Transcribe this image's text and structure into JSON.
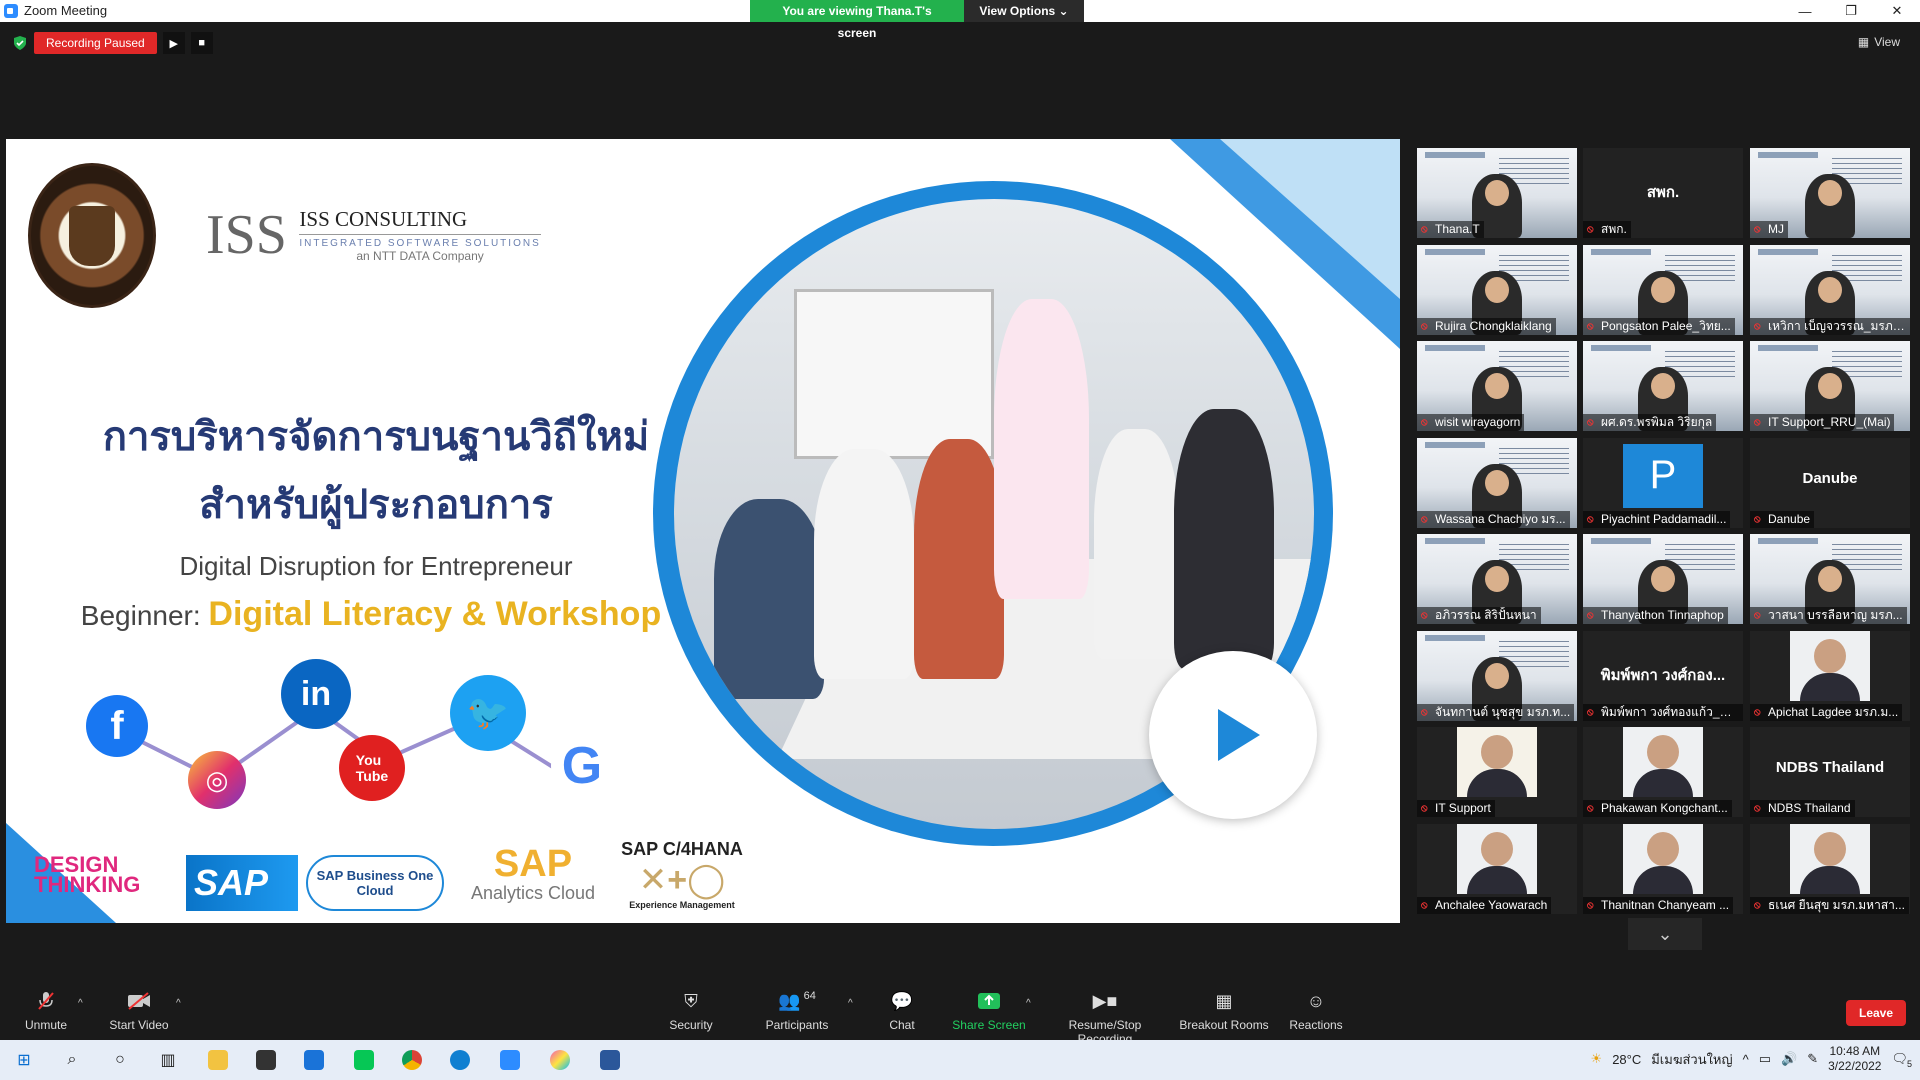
{
  "window": {
    "title": "Zoom Meeting",
    "controls": [
      "—",
      "❐",
      "✕"
    ]
  },
  "viewing": {
    "message": "You are viewing Thana.T's screen",
    "options_label": "View Options ⌄"
  },
  "recording": {
    "status": "Recording Paused"
  },
  "view_button": {
    "label": "View"
  },
  "slide": {
    "company_name": "ISS CONSULTING",
    "company_sub": "INTEGRATED SOFTWARE SOLUTIONS",
    "company_tag": "an NTT DATA Company",
    "iss_mark": "ISS",
    "title_line1": "การบริหารจัดการบนฐานวิถีใหม่",
    "title_line2": "สำหรับผู้ประกอบการ",
    "subtitle": "Digital Disruption for Entrepreneur",
    "level_prefix": "Beginner: ",
    "level_title": "Digital Literacy & Workshop",
    "brands": {
      "design_thinking": "DESIGN THINKING",
      "sap": "SAP",
      "sap_b1": "SAP Business One Cloud",
      "sap_ac_top": "SAP",
      "sap_ac_bottom": "Analytics Cloud",
      "c4hana": "SAP C/4HANA",
      "xm": "Experience Management"
    }
  },
  "gallery": [
    {
      "name": "Thana.T",
      "type": "video",
      "active": true
    },
    {
      "name": "สพก.",
      "type": "text",
      "big": "สพก."
    },
    {
      "name": "MJ",
      "type": "video"
    },
    {
      "name": "Rujira Chongklaiklang",
      "type": "video"
    },
    {
      "name": "Pongsaton Palee_วิทย...",
      "type": "video"
    },
    {
      "name": "เหวิกา เบ็ญจวรรณ_มรภ ...",
      "type": "video"
    },
    {
      "name": "wisit wirayagorn",
      "type": "video"
    },
    {
      "name": "ผศ.ดร.พรพิมล วิริยกุล",
      "type": "video"
    },
    {
      "name": "IT Support_RRU_(Mai)",
      "type": "video"
    },
    {
      "name": "Wassana Chachiyo มร...",
      "type": "video"
    },
    {
      "name": "Piyachint Paddamadil...",
      "type": "letter",
      "big": "P"
    },
    {
      "name": "Danube",
      "type": "text",
      "big": "Danube"
    },
    {
      "name": "อภิวรรณ สิริปั้นหนา",
      "type": "video"
    },
    {
      "name": "Thanyathon Tinnaphop",
      "type": "video"
    },
    {
      "name": "วาสนา บรรลือหาญ มรภ...",
      "type": "video"
    },
    {
      "name": "จันทกานต์ นุชสุข มรภ.ท...",
      "type": "video"
    },
    {
      "name": "พิมพ์พกา วงศ์ทองแก้ว_มร...",
      "type": "text",
      "big": "พิมพ์พกา วงศ์กอง..."
    },
    {
      "name": "Apichat Lagdee มรภ.ม...",
      "type": "portrait"
    },
    {
      "name": "IT Support",
      "type": "logo"
    },
    {
      "name": "Phakawan Kongchant...",
      "type": "portrait"
    },
    {
      "name": "NDBS Thailand",
      "type": "text",
      "big": "NDBS Thailand"
    },
    {
      "name": "Anchalee Yaowarach",
      "type": "portrait"
    },
    {
      "name": "Thanitnan Chanyeam ...",
      "type": "portrait"
    },
    {
      "name": "ธเนศ ยืนสุข มรภ.มหาสา...",
      "type": "portrait"
    }
  ],
  "toolbar": {
    "unmute": "Unmute",
    "start_video": "Start Video",
    "security": "Security",
    "participants": "Participants",
    "participant_count": "64",
    "chat": "Chat",
    "share_screen": "Share Screen",
    "resume_stop": "Resume/Stop Recording",
    "breakout": "Breakout Rooms",
    "reactions": "Reactions",
    "leave": "Leave"
  },
  "taskbar": {
    "weather": "28°C",
    "weather_text": "มีเมฆส่วนใหญ่",
    "time": "10:48 AM",
    "date": "3/22/2022",
    "notif_count": "5"
  },
  "colors": {
    "zoom_blue": "#2d8cff",
    "green": "#23b14d",
    "red": "#e02828",
    "slide_blue": "#1e88d8",
    "gold": "#e9b321"
  }
}
